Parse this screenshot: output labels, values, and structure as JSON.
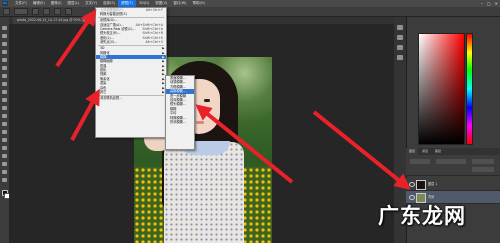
{
  "menubar": {
    "logo": "Ps",
    "items": [
      "文件(F)",
      "编辑(E)",
      "图像(I)",
      "图层(L)",
      "文字(Y)",
      "选择(S)",
      "滤镜(T)",
      "3D(D)",
      "视图(V)",
      "窗口(W)",
      "帮助(H)"
    ],
    "active_index": 6
  },
  "document_tab": "photo_2022-06-15_14-17-44.jpg @ 50% (图层 1, RGB/8) ×",
  "filter_menu": {
    "items": [
      {
        "label": "上次滤镜操作(F)",
        "shortcut": "Alt+Ctrl+F",
        "disabled": true
      },
      {
        "label": "转换为智能滤镜(S)",
        "shortcut": ""
      },
      {
        "sep": true
      },
      {
        "label": "滤镜库(G)...",
        "shortcut": ""
      },
      {
        "label": "自适应广角(A)...",
        "shortcut": "Alt+Shift+Ctrl+A"
      },
      {
        "label": "Camera Raw 滤镜(C)...",
        "shortcut": "Shift+Ctrl+A"
      },
      {
        "label": "镜头校正(R)...",
        "shortcut": "Shift+Ctrl+R"
      },
      {
        "label": "液化(L)...",
        "shortcut": "Shift+Ctrl+X"
      },
      {
        "label": "消失点(V)...",
        "shortcut": "Alt+Ctrl+V"
      },
      {
        "sep": true
      },
      {
        "label": "3D",
        "submenu": true
      },
      {
        "label": "风格化",
        "submenu": true
      },
      {
        "label": "模糊",
        "submenu": true,
        "highlighted": true
      },
      {
        "label": "模糊画廊",
        "submenu": true
      },
      {
        "label": "扭曲",
        "submenu": true
      },
      {
        "label": "锐化",
        "submenu": true
      },
      {
        "label": "视频",
        "submenu": true
      },
      {
        "label": "像素化",
        "submenu": true
      },
      {
        "label": "渲染",
        "submenu": true
      },
      {
        "label": "杂色",
        "submenu": true
      },
      {
        "label": "其它",
        "submenu": true
      },
      {
        "sep": true
      },
      {
        "label": "浏览联机滤镜...",
        "shortcut": ""
      }
    ]
  },
  "blur_menu": {
    "items": [
      {
        "label": "表面模糊..."
      },
      {
        "label": "动感模糊..."
      },
      {
        "label": "方框模糊..."
      },
      {
        "label": "高斯模糊...",
        "highlighted": true
      },
      {
        "label": "进一步模糊"
      },
      {
        "label": "径向模糊..."
      },
      {
        "label": "镜头模糊..."
      },
      {
        "label": "模糊"
      },
      {
        "label": "平均"
      },
      {
        "label": "特殊模糊..."
      },
      {
        "label": "形状模糊..."
      }
    ]
  },
  "panels": {
    "tabs": [
      "图层",
      "通道",
      "路径"
    ],
    "layers": [
      {
        "name": "图层 1",
        "selected": false
      },
      {
        "name": "背景",
        "selected": true
      }
    ]
  },
  "watermark": "广东龙网",
  "colors": {
    "menu_highlight": "#2f74d0",
    "arrow": "#e8212b",
    "menubar_active": "#1473e6"
  }
}
